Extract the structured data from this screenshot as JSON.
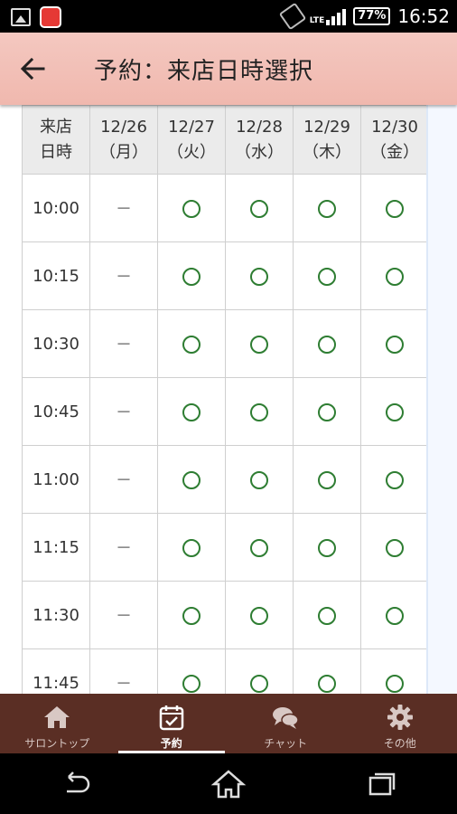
{
  "status_bar": {
    "lte": "LTE",
    "battery": "77%",
    "time": "16:52"
  },
  "app_bar": {
    "title": "予約：来店日時選択"
  },
  "schedule": {
    "header_first_line1": "来店",
    "header_first_line2": "日時",
    "days": [
      {
        "date": "12/26",
        "weekday": "（月）"
      },
      {
        "date": "12/27",
        "weekday": "（火）"
      },
      {
        "date": "12/28",
        "weekday": "（水）"
      },
      {
        "date": "12/29",
        "weekday": "（木）"
      },
      {
        "date": "12/30",
        "weekday": "（金）"
      }
    ],
    "unavailable_mark": "－",
    "rows": [
      {
        "time": "10:00",
        "slots": [
          "unavailable",
          "available",
          "available",
          "available",
          "available"
        ]
      },
      {
        "time": "10:15",
        "slots": [
          "unavailable",
          "available",
          "available",
          "available",
          "available"
        ]
      },
      {
        "time": "10:30",
        "slots": [
          "unavailable",
          "available",
          "available",
          "available",
          "available"
        ]
      },
      {
        "time": "10:45",
        "slots": [
          "unavailable",
          "available",
          "available",
          "available",
          "available"
        ]
      },
      {
        "time": "11:00",
        "slots": [
          "unavailable",
          "available",
          "available",
          "available",
          "available"
        ]
      },
      {
        "time": "11:15",
        "slots": [
          "unavailable",
          "available",
          "available",
          "available",
          "available"
        ]
      },
      {
        "time": "11:30",
        "slots": [
          "unavailable",
          "available",
          "available",
          "available",
          "available"
        ]
      },
      {
        "time": "11:45",
        "slots": [
          "unavailable",
          "available",
          "available",
          "available",
          "available"
        ]
      }
    ]
  },
  "bottom_nav": {
    "items": [
      {
        "label": "サロントップ",
        "icon": "home-icon"
      },
      {
        "label": "予約",
        "icon": "calendar-check-icon",
        "active": true
      },
      {
        "label": "チャット",
        "icon": "chat-bubbles-icon"
      },
      {
        "label": "その他",
        "icon": "gear-icon"
      }
    ]
  },
  "colors": {
    "app_bar": "#f2c0b6",
    "bottom_nav": "#5a2e24",
    "available_circle": "#2e7d32"
  }
}
